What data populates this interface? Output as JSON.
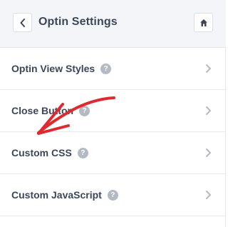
{
  "header": {
    "title": "Optin Settings",
    "back_icon": "chevron-left-icon",
    "home_icon": "home-icon"
  },
  "menu": {
    "items": [
      {
        "label": "Optin View Styles",
        "help": "?"
      },
      {
        "label": "Close Button",
        "help": "?"
      },
      {
        "label": "Custom CSS",
        "help": "?"
      },
      {
        "label": "Custom JavaScript",
        "help": "?"
      }
    ]
  },
  "colors": {
    "header_bg": "#f4f5f8",
    "text": "#3b4657",
    "help_icon": "#b4bac4",
    "chevron": "#b4bac4",
    "annotation_arrow": "#e0292f"
  }
}
